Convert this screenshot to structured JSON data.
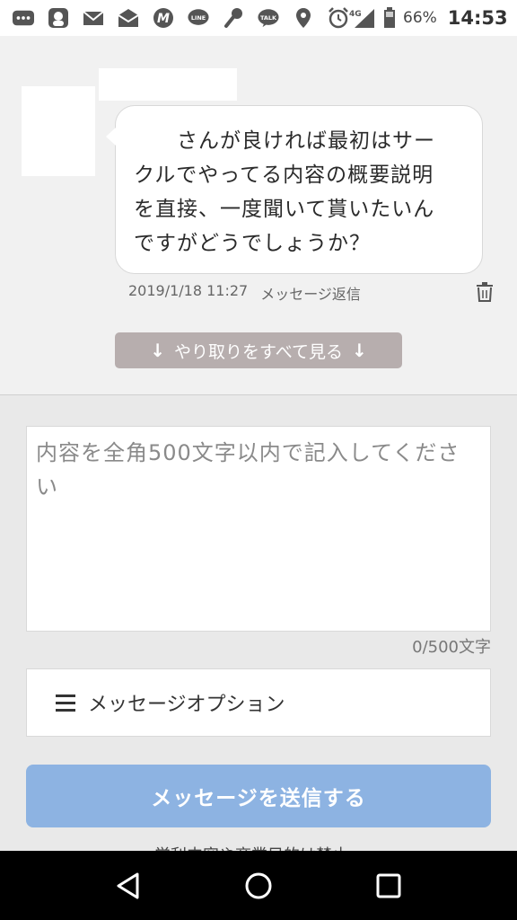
{
  "status_bar": {
    "icons": [
      "more-icon",
      "app-icon",
      "mail-icon",
      "mail-open-icon",
      "m-app-icon",
      "line-icon",
      "mic-icon",
      "talk-icon",
      "location-icon",
      "alarm-icon",
      "signal-icon",
      "battery-icon"
    ],
    "network": "4G",
    "battery_percent": "66%",
    "time": "14:53"
  },
  "message": {
    "text": "　　さんが良ければ最初はサー\nクルでやってる内容の概要説明\nを直接、一度聞いて貰いたいん\nですがどうでしょうか？",
    "date": "2019/1/18 11:27",
    "type": "メッセージ返信"
  },
  "see_all": {
    "label": "やり取りをすべて見る",
    "arrow": "↓"
  },
  "compose": {
    "placeholder": "内容を全角500文字以内で記入してください",
    "counter": "0/500文字",
    "options_label": "メッセージオプション",
    "send_label": "メッセージを送信する",
    "footnote": "営利内容や商業目的は禁止"
  },
  "colors": {
    "send_button": "#8db3e2",
    "see_all_button": "#b7aeae",
    "background": "#e9e9e9"
  }
}
